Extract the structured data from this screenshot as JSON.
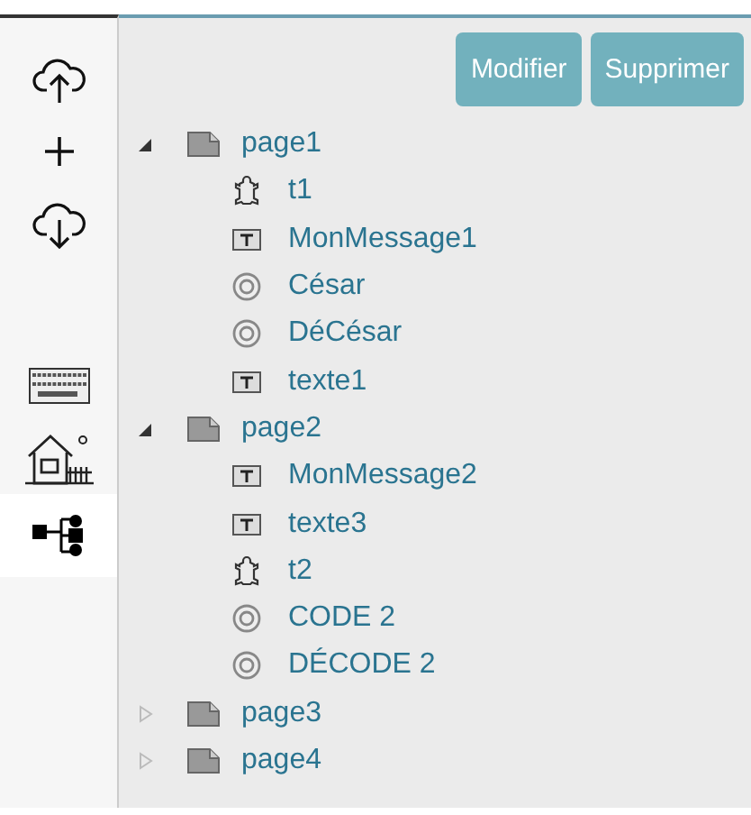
{
  "sidebar": {
    "tools": [
      {
        "kind": "upload",
        "selected": false
      },
      {
        "kind": "add",
        "selected": false
      },
      {
        "kind": "download",
        "selected": false
      },
      {
        "kind": "keyboard",
        "selected": false
      },
      {
        "kind": "house",
        "selected": false
      },
      {
        "kind": "tree",
        "selected": true
      }
    ]
  },
  "buttons": [
    {
      "label": "Modifier"
    },
    {
      "label": "Supprimer"
    }
  ],
  "tree": [
    {
      "label": "page1",
      "kind": "page",
      "expanded": true,
      "children": [
        {
          "label": "t1",
          "kind": "turtle"
        },
        {
          "label": "MonMessage1",
          "kind": "text"
        },
        {
          "label": "César",
          "kind": "target"
        },
        {
          "label": "DéCésar",
          "kind": "target"
        },
        {
          "label": "texte1",
          "kind": "text"
        }
      ]
    },
    {
      "label": "page2",
      "kind": "page",
      "expanded": true,
      "children": [
        {
          "label": "MonMessage2",
          "kind": "text"
        },
        {
          "label": "texte3",
          "kind": "text"
        },
        {
          "label": "t2",
          "kind": "turtle"
        },
        {
          "label": "CODE 2",
          "kind": "target"
        },
        {
          "label": "DÉCODE 2",
          "kind": "target"
        }
      ]
    },
    {
      "label": "page3",
      "kind": "page",
      "expanded": false
    },
    {
      "label": "page4",
      "kind": "page",
      "expanded": false
    }
  ]
}
